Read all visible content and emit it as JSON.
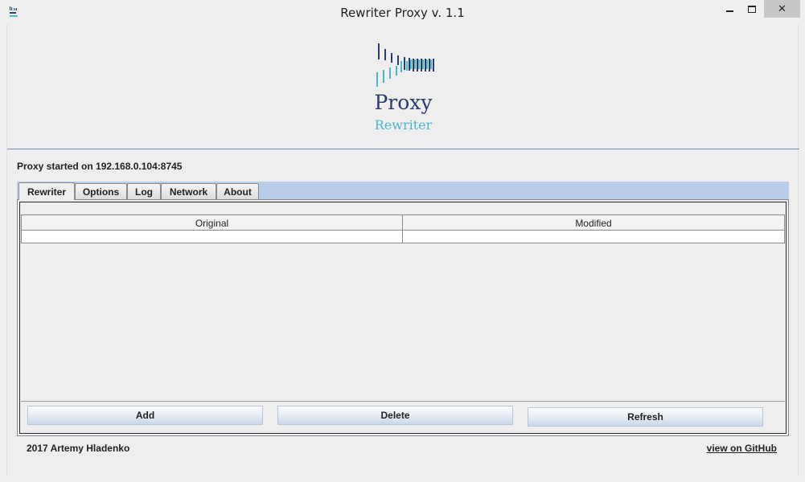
{
  "window": {
    "title": "Rewriter Proxy v. 1.1",
    "close_glyph": "✕"
  },
  "logo": {
    "name": "Proxy",
    "subtitle": "Rewriter",
    "primary_color": "#2b3d6e",
    "accent_color": "#4db6cf"
  },
  "status": {
    "text": "Proxy started on 192.168.0.104:8745"
  },
  "tabs": [
    {
      "label": "Rewriter",
      "active": true
    },
    {
      "label": "Options",
      "active": false
    },
    {
      "label": "Log",
      "active": false
    },
    {
      "label": "Network",
      "active": false
    },
    {
      "label": "About",
      "active": false
    }
  ],
  "table": {
    "columns": [
      "Original",
      "Modified"
    ],
    "rows": [
      [
        "",
        ""
      ]
    ]
  },
  "actions": {
    "add_label": "Add",
    "delete_label": "Delete",
    "refresh_label": "Refresh"
  },
  "footer": {
    "credit": "2017 Artemy Hladenko",
    "github_link": "view on GitHub"
  },
  "icons": {
    "app": "proxy-app-icon",
    "minimize": "minimize-icon",
    "maximize": "maximize-icon",
    "close": "close-icon"
  }
}
